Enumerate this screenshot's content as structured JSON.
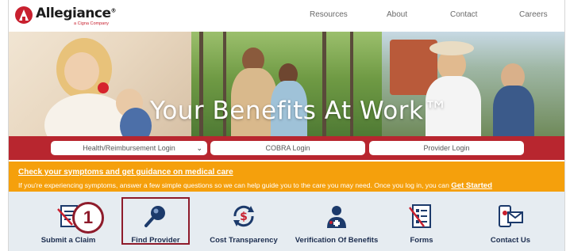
{
  "brand": {
    "name": "Allegiance",
    "tagline": "a Cigna Company",
    "trademark": "®",
    "color": "#c8202f"
  },
  "nav": {
    "items": [
      "Resources",
      "About",
      "Contact",
      "Careers"
    ]
  },
  "hero": {
    "title": "Your Benefits At Work™"
  },
  "login": {
    "health_label": "Health/Reimbursement Login",
    "cobra_label": "COBRA Login",
    "provider_label": "Provider Login",
    "band_color": "#b8262f"
  },
  "symptoms": {
    "heading": "Check your symptoms and get guidance on medical care",
    "body": "If you're experiencing symptoms, answer a few simple questions so we can help guide you to the care you may need. Once you log in, you can",
    "cta": "Get Started",
    "color": "#f5a00c"
  },
  "quick_links": [
    {
      "label": "Submit a Claim",
      "icon": "claim-form-icon"
    },
    {
      "label": "Find Provider",
      "icon": "magnifier-icon"
    },
    {
      "label": "Cost Transparency",
      "icon": "dollar-cycle-icon"
    },
    {
      "label": "Verification Of Benefits",
      "icon": "doctor-icon"
    },
    {
      "label": "Forms",
      "icon": "form-icon"
    },
    {
      "label": "Contact Us",
      "icon": "contact-icon"
    }
  ],
  "annotation": {
    "step": "1"
  }
}
